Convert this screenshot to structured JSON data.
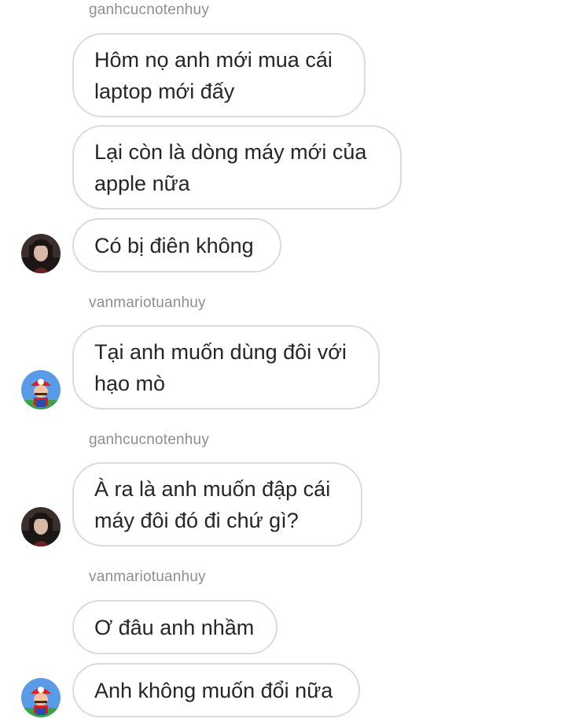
{
  "messages": [
    {
      "username": "ganhcucnotenhuy"
    },
    {
      "text": "Hôm nọ anh mới mua cái\nlaptop mới đấy"
    },
    {
      "text": "Lại còn là dòng máy mới của\napple nữa"
    },
    {
      "text": "Có bị điên không",
      "avatar": "avatar-dark-hair"
    },
    {
      "username": "vanmariotuanhuy"
    },
    {
      "text": "Tại anh muốn dùng đôi với\nhạo mò",
      "avatar": "avatar-mario"
    },
    {
      "username": "ganhcucnotenhuy"
    },
    {
      "text": "À ra là anh muốn đập cái\nmáy đôi đó đi chứ gì?",
      "avatar": "avatar-dark-hair"
    },
    {
      "username": "vanmariotuanhuy"
    },
    {
      "text": "Ơ đâu anh nhầm"
    },
    {
      "text": "Anh không muốn đổi nữa",
      "avatar": "avatar-mario"
    }
  ]
}
